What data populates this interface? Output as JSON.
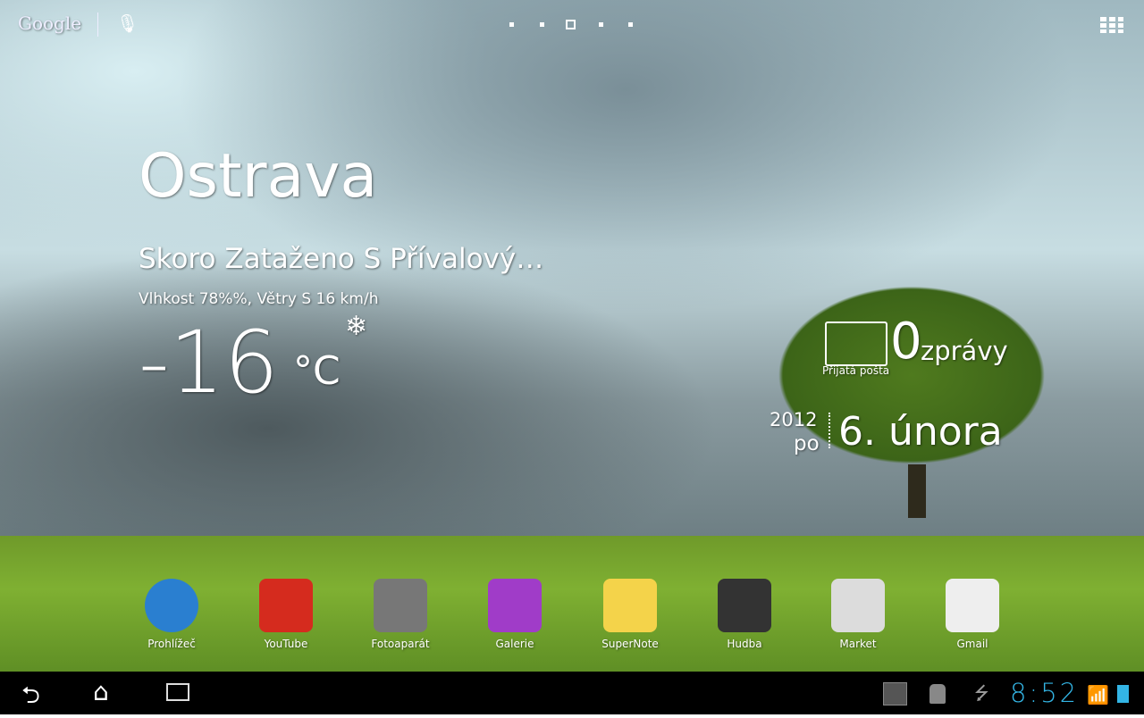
{
  "search": {
    "google_label": "Google"
  },
  "weather": {
    "city": "Ostrava",
    "condition": "Skoro Zataženo S Přívalový…",
    "details": "Vlhkost 78%%, Větry S 16 km/h",
    "temperature": "-16",
    "unit": "°C"
  },
  "mail": {
    "count": "0",
    "count_label": "zprávy",
    "inbox_label": "Přijatá pošta"
  },
  "date": {
    "year": "2012",
    "weekday": "po",
    "day_month": "6. února"
  },
  "apps": [
    {
      "label": "Prohlížeč",
      "color": "#2a7fd0"
    },
    {
      "label": "YouTube",
      "color": "#d52b1e"
    },
    {
      "label": "Fotoaparát",
      "color": "#777"
    },
    {
      "label": "Galerie",
      "color": "#a03cc8"
    },
    {
      "label": "SuperNote",
      "color": "#f4d34a"
    },
    {
      "label": "Hudba",
      "color": "#333"
    },
    {
      "label": "Market",
      "color": "#dcdcdc"
    },
    {
      "label": "Gmail",
      "color": "#eee"
    }
  ],
  "status": {
    "time": "8:52",
    "accent": "#33b5e5"
  }
}
